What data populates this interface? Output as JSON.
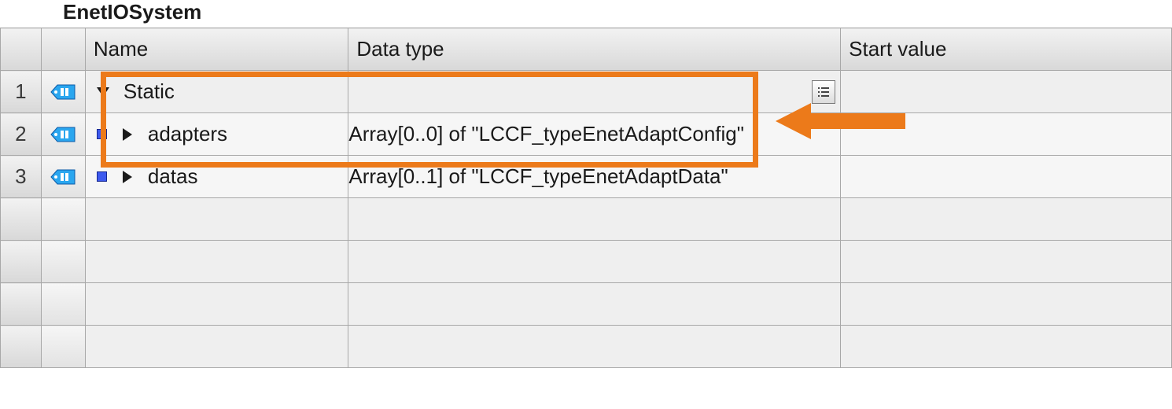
{
  "title": "EnetIOSystem",
  "headers": {
    "name": "Name",
    "datatype": "Data type",
    "startvalue": "Start value"
  },
  "rows": [
    {
      "num": "1",
      "icon": "tag",
      "expand": "down",
      "bullet": false,
      "indent": 1,
      "name": "Static",
      "datatype": "",
      "start": "",
      "showDropdown": true,
      "light": false
    },
    {
      "num": "2",
      "icon": "tag",
      "expand": "right",
      "bullet": true,
      "indent": 2,
      "name": "adapters",
      "datatype": "Array[0..0] of \"LCCF_typeEnetAdaptConfig\"",
      "start": "",
      "showDropdown": false,
      "light": true
    },
    {
      "num": "3",
      "icon": "tag",
      "expand": "right",
      "bullet": true,
      "indent": 2,
      "name": "datas",
      "datatype": "Array[0..1] of \"LCCF_typeEnetAdaptData\"",
      "start": "",
      "showDropdown": false,
      "light": true
    }
  ],
  "emptyRows": 4,
  "annotation": {
    "highlightColor": "#ec7a1a"
  }
}
